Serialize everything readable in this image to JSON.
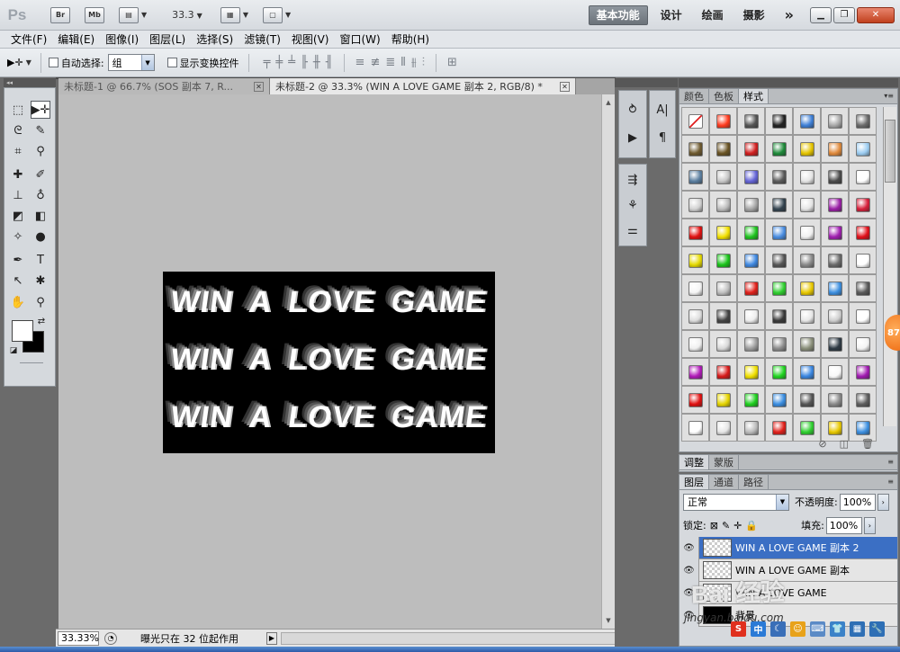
{
  "appbar": {
    "logo": "Ps",
    "bridge": "Br",
    "minibridge": "Mb",
    "zoom": "33.3",
    "workspaces": [
      "基本功能",
      "设计",
      "绘画",
      "摄影"
    ],
    "more": "»"
  },
  "menu": [
    "文件(F)",
    "编辑(E)",
    "图像(I)",
    "图层(L)",
    "选择(S)",
    "滤镜(T)",
    "视图(V)",
    "窗口(W)",
    "帮助(H)"
  ],
  "options": {
    "auto_select_label": "自动选择:",
    "auto_select_value": "组",
    "show_transform_label": "显示变换控件"
  },
  "documents": {
    "tabs": [
      {
        "title": "未标题-1 @ 66.7% (SOS 副本 7, R...",
        "active": false
      },
      {
        "title": "未标题-2 @ 33.3% (WIN A LOVE GAME 副本 2, RGB/8) *",
        "active": true
      }
    ]
  },
  "artwork": {
    "lines": [
      [
        "WIN",
        "A",
        "LOVE",
        "GAME"
      ],
      [
        "WIN",
        "A",
        "LOVE",
        "GAME"
      ],
      [
        "WIN",
        "A",
        "LOVE",
        "GAME"
      ]
    ]
  },
  "status": {
    "zoom": "33.33%",
    "message": "曝光只在 32 位起作用"
  },
  "panels": {
    "styles_tabs": [
      "颜色",
      "色板",
      "样式"
    ],
    "adjust_tabs": [
      "调整",
      "蒙版"
    ],
    "layers_tabs": [
      "图层",
      "通道",
      "路径"
    ],
    "blend_mode": "正常",
    "opacity_label": "不透明度:",
    "opacity_value": "100%",
    "lock_label": "锁定:",
    "fill_label": "填充:",
    "fill_value": "100%",
    "layers": [
      {
        "name": "WIN A LOVE GAME 副本 2",
        "selected": true,
        "thumb": "transparent"
      },
      {
        "name": "WIN A LOVE GAME 副本",
        "selected": false,
        "thumb": "transparent"
      },
      {
        "name": "WIN A LOVE GAME",
        "selected": false,
        "thumb": "transparent"
      },
      {
        "name": "背景",
        "selected": false,
        "thumb": "black"
      }
    ]
  },
  "style_colors": [
    "#ffffff",
    "#ff3b1f",
    "#555555",
    "#222222",
    "#3e7fd6",
    "#a9a9a9",
    "#6b6b6b",
    "#6e5a2f",
    "#6a5424",
    "#d11f1f",
    "#1f8a3a",
    "#e5c400",
    "#e08a3c",
    "#9ccdf2",
    "#5b7fa0",
    "#c9c9c9",
    "#6464d6",
    "#5b5b5b",
    "#e6e6e6",
    "#4b4b4b",
    "#ffffff",
    "#d2d2d2",
    "#bdbdbd",
    "#a6a6a6",
    "#33434f",
    "#e5e5e5",
    "#9a1fa6",
    "#d61f3a",
    "#e01010",
    "#f2e000",
    "#1fc41f",
    "#4a8de0",
    "#f0f0f0",
    "#a01fb0",
    "#e0101a",
    "#e5d900",
    "#19c419",
    "#3f88e0",
    "#555555",
    "#8a8a8a",
    "#6a6a6a",
    "#ffffff",
    "#f5f5f5",
    "#c0c0c0",
    "#e0201a",
    "#2fcf2f",
    "#e8c800",
    "#3c8fe0",
    "#5a5a5a",
    "#dedede",
    "#444444",
    "#eeeeee",
    "#3a3a3a",
    "#e8e8e8",
    "#cfcfcf",
    "#ffffff",
    "#f0f0f0",
    "#d9d9d9",
    "#9e9e9e",
    "#8d8d8d",
    "#8a8f7a",
    "#2e3a44",
    "#f4f4f4",
    "#b01ab8",
    "#d61a1a",
    "#f0e000",
    "#21d421",
    "#3a86e0",
    "#f8f8f8",
    "#a01ab0",
    "#e01010",
    "#e5d400",
    "#1fcf1f",
    "#3a8de0",
    "#555555",
    "#8a8a8a",
    "#5e5e5e",
    "#ffffff",
    "#e6e6e6",
    "#bcbcbc",
    "#e0201a",
    "#2fcf2f",
    "#e8c800",
    "#3c8fe0"
  ],
  "watermark": {
    "text": "Bai 经验",
    "url": "jingyan.baidu.com"
  },
  "badge": "87"
}
